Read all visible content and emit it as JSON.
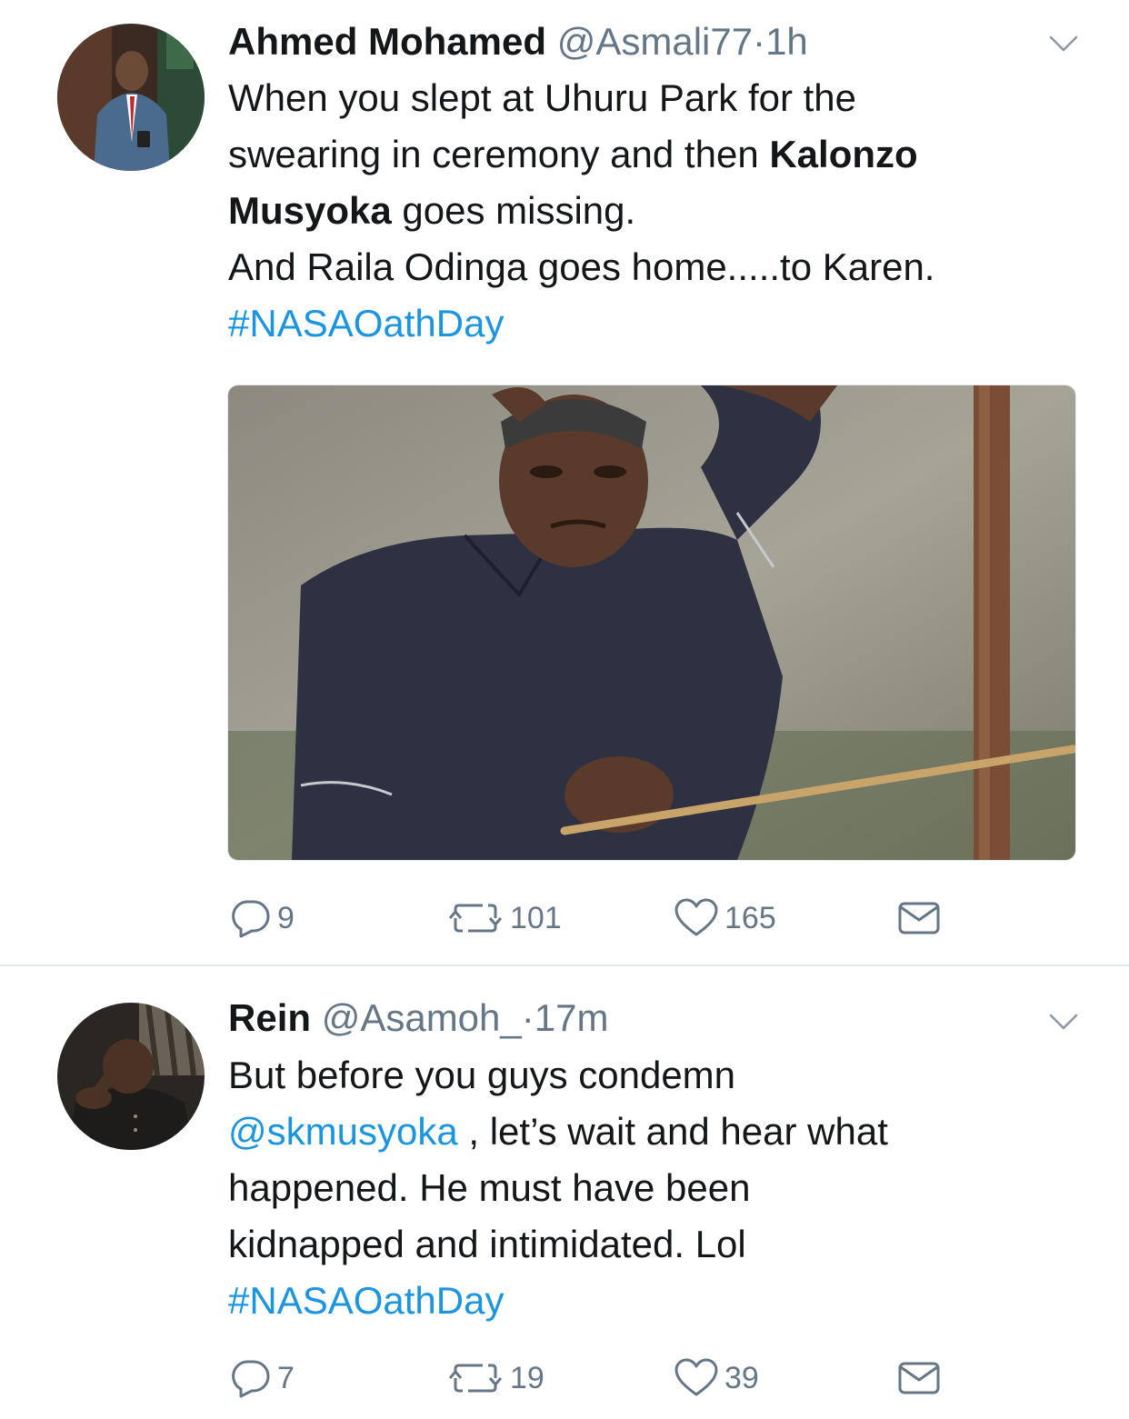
{
  "tweets": [
    {
      "name": "Ahmed Mohamed",
      "handle": "@Asmali77",
      "separator": "·",
      "time": "1h",
      "lines": [
        [
          {
            "t": "When you slept at Uhuru Park for the"
          }
        ],
        [
          {
            "t": "swearing in ceremony and then "
          },
          {
            "t": "Kalonzo",
            "b": true
          }
        ],
        [
          {
            "t": "Musyoka",
            "b": true
          },
          {
            "t": " goes missing."
          }
        ],
        [
          {
            "t": "And Raila Odinga goes home.....to Karen."
          }
        ],
        [
          {
            "t": "#NASAOathDay",
            "link": true
          }
        ]
      ],
      "media": "photo",
      "counts": {
        "replies": "9",
        "retweets": "101",
        "likes": "165"
      }
    },
    {
      "name": "Rein",
      "handle": "@Asamoh_",
      "separator": "·",
      "time": "17m",
      "lines": [
        [
          {
            "t": "But before you guys condemn"
          }
        ],
        [
          {
            "t": "@skmusyoka",
            "link": true
          },
          {
            "t": " , let’s wait and hear what"
          }
        ],
        [
          {
            "t": "happened. He must have been"
          }
        ],
        [
          {
            "t": "kidnapped and intimidated. Lol"
          }
        ],
        [
          {
            "t": "#NASAOathDay",
            "link": true
          }
        ]
      ],
      "counts": {
        "replies": "7",
        "retweets": "19",
        "likes": "39"
      }
    }
  ],
  "icons": {
    "reply": "reply-icon",
    "retweet": "retweet-icon",
    "like": "heart-icon",
    "dm": "envelope-icon",
    "more": "chevron-down-icon"
  },
  "colors": {
    "link": "#1b95e0",
    "secondary_text": "#657786",
    "primary_text": "#14171a",
    "divider": "#e1e8ed"
  }
}
